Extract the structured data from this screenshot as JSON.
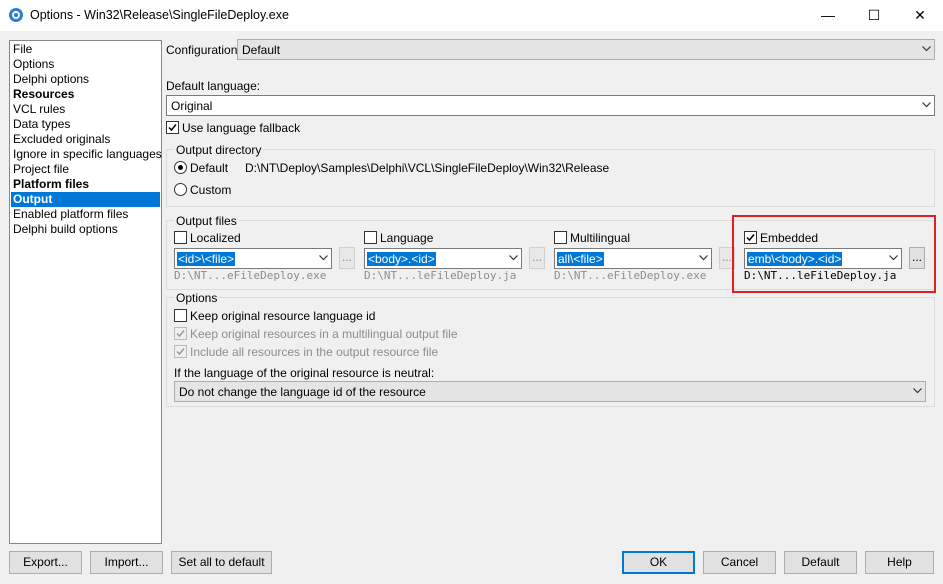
{
  "window": {
    "title": "Options - Win32\\Release\\SingleFileDeploy.exe",
    "minimize_glyph": "—",
    "maximize_glyph": "☐",
    "close_glyph": "✕"
  },
  "nav": {
    "items": [
      {
        "label": "File"
      },
      {
        "label": "Options"
      },
      {
        "label": "Delphi options"
      },
      {
        "label": "Resources"
      },
      {
        "label": "VCL rules"
      },
      {
        "label": "Data types"
      },
      {
        "label": "Excluded originals"
      },
      {
        "label": "Ignore in specific languages"
      },
      {
        "label": "Project file"
      },
      {
        "label": "Platform files"
      },
      {
        "label": "Output"
      },
      {
        "label": "Enabled platform files"
      },
      {
        "label": "Delphi build options"
      }
    ],
    "selected": "Output"
  },
  "configuration": {
    "label": "Configuration:",
    "value": "Default"
  },
  "default_language": {
    "label": "Default language:",
    "value": "Original"
  },
  "use_language_fallback": {
    "label": "Use language fallback",
    "checked": true
  },
  "output_directory": {
    "group_label": "Output directory",
    "default_label": "Default",
    "default_path": "D:\\NT\\Deploy\\Samples\\Delphi\\VCL\\SingleFileDeploy\\Win32\\Release",
    "custom_label": "Custom",
    "selected": "Default"
  },
  "output_files": {
    "group_label": "Output files",
    "columns": [
      {
        "label": "Localized",
        "checked": false,
        "pattern": "<id>\\<file>",
        "path": "D:\\NT...eFileDeploy.exe",
        "browse": "..."
      },
      {
        "label": "Language",
        "checked": false,
        "pattern": "<body>.<id>",
        "path": "D:\\NT...leFileDeploy.ja",
        "browse": "..."
      },
      {
        "label": "Multilingual",
        "checked": false,
        "pattern": "all\\<file>",
        "path": "D:\\NT...eFileDeploy.exe",
        "browse": "..."
      },
      {
        "label": "Embedded",
        "checked": true,
        "pattern": "emb\\<body>.<id>",
        "path": "D:\\NT...leFileDeploy.ja",
        "browse": "..."
      }
    ]
  },
  "options": {
    "group_label": "Options",
    "keep_original_id": {
      "label": "Keep original resource language id",
      "checked": false
    },
    "keep_multilingual": {
      "label": "Keep original resources in a multilingual output file",
      "checked": true,
      "disabled": true
    },
    "include_all": {
      "label": "Include all resources in the output resource file",
      "checked": true,
      "disabled": true
    },
    "neutral_label": "If the language of the original resource is neutral:",
    "neutral_value": "Do not change the language id of the resource"
  },
  "buttons": {
    "export": "Export...",
    "import": "Import...",
    "set_all_default": "Set all to default",
    "ok": "OK",
    "cancel": "Cancel",
    "default": "Default",
    "help": "Help"
  },
  "colors": {
    "selection": "#0078d7",
    "highlight": "#e02020"
  }
}
